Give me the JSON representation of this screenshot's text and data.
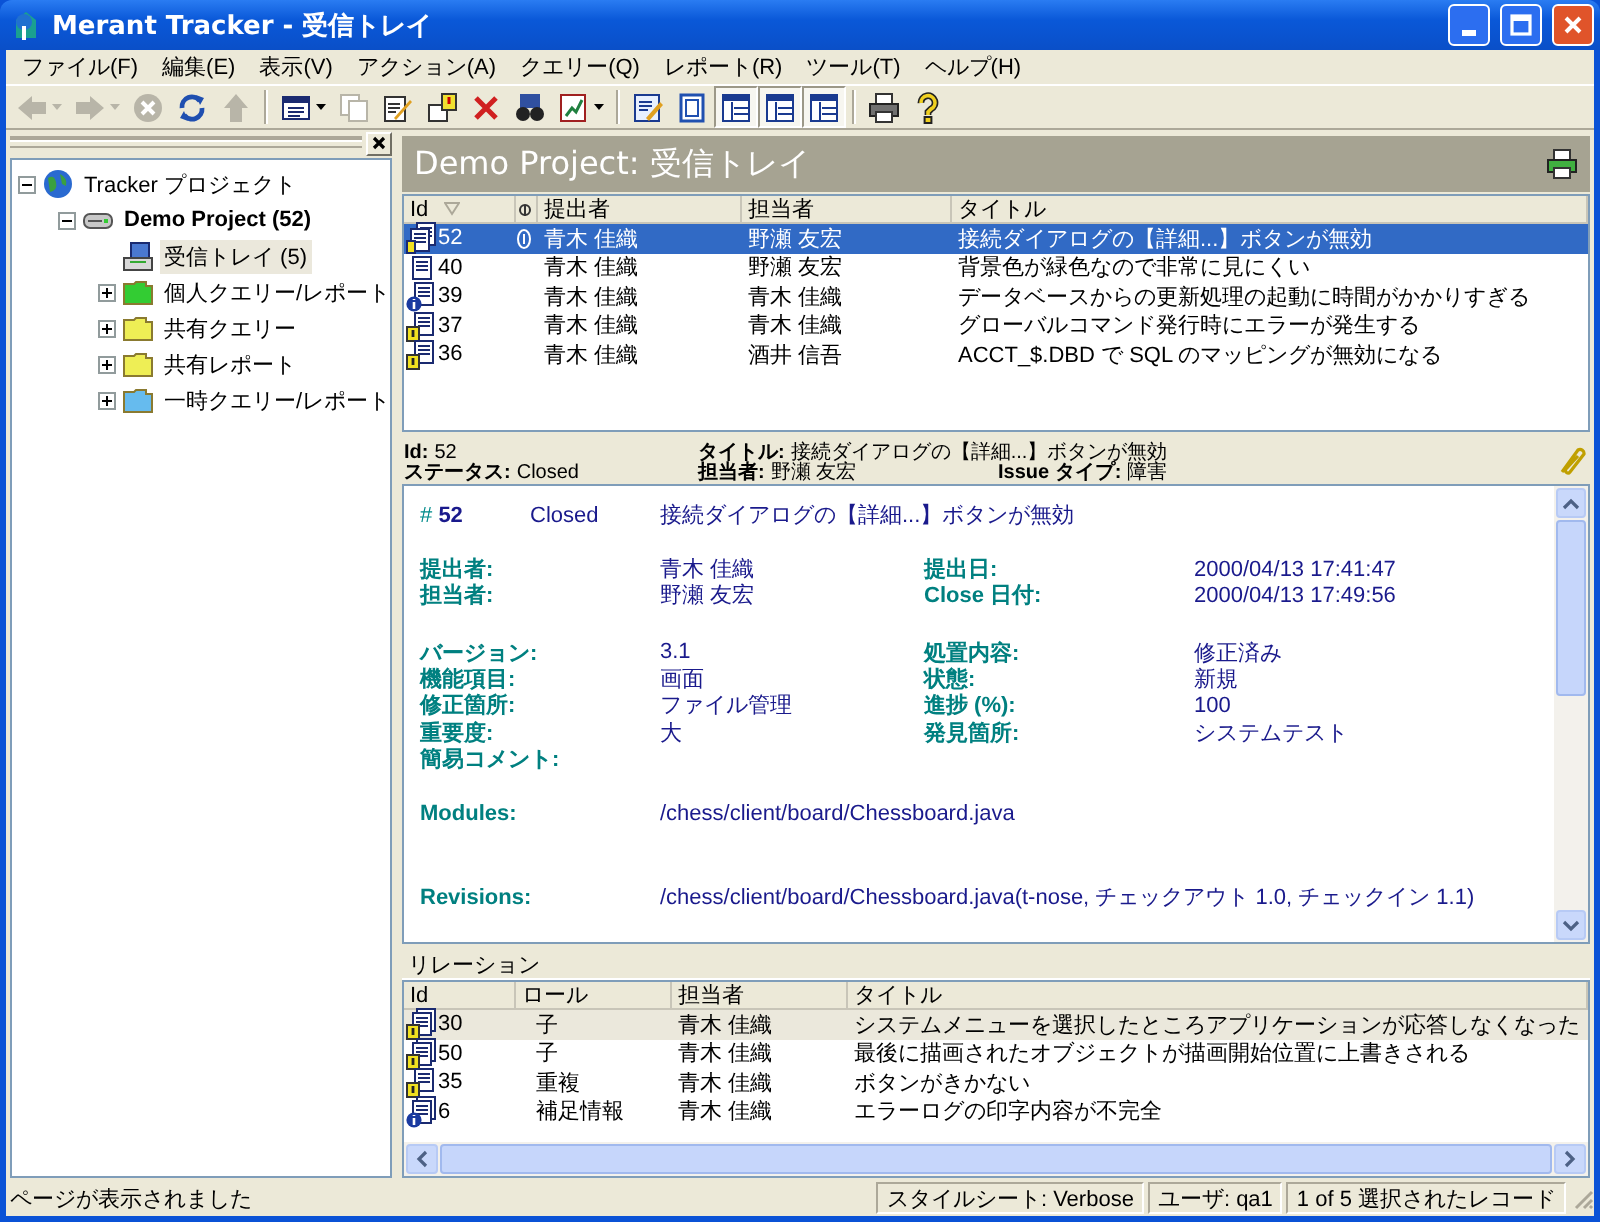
{
  "window": {
    "title": "Merant Tracker - 受信トレイ"
  },
  "menu": [
    "ファイル(F)",
    "編集(E)",
    "表示(V)",
    "アクション(A)",
    "クエリー(Q)",
    "レポート(R)",
    "ツール(T)",
    "ヘルプ(H)"
  ],
  "toolbar": [
    {
      "kind": "back",
      "disabled": true,
      "pressed": false,
      "dropdown": true
    },
    {
      "kind": "forward",
      "disabled": true,
      "pressed": false,
      "dropdown": true
    },
    {
      "kind": "stop",
      "disabled": true,
      "pressed": false
    },
    {
      "kind": "refresh",
      "disabled": false,
      "pressed": false
    },
    {
      "kind": "up",
      "disabled": true,
      "pressed": false
    },
    {
      "kind": "separator"
    },
    {
      "kind": "view",
      "disabled": false,
      "pressed": false,
      "dropdown": true
    },
    {
      "kind": "copy",
      "disabled": true,
      "pressed": false
    },
    {
      "kind": "edit",
      "disabled": false,
      "pressed": false
    },
    {
      "kind": "flag",
      "disabled": false,
      "pressed": false
    },
    {
      "kind": "delete",
      "disabled": false,
      "pressed": false
    },
    {
      "kind": "find",
      "disabled": false,
      "pressed": false
    },
    {
      "kind": "chart",
      "disabled": false,
      "pressed": false,
      "dropdown": true
    },
    {
      "kind": "separator"
    },
    {
      "kind": "note",
      "disabled": false,
      "pressed": false
    },
    {
      "kind": "page",
      "disabled": false,
      "pressed": false
    },
    {
      "kind": "layout",
      "disabled": false,
      "pressed": true
    },
    {
      "kind": "layout",
      "disabled": false,
      "pressed": true
    },
    {
      "kind": "layout",
      "disabled": false,
      "pressed": true
    },
    {
      "kind": "separator"
    },
    {
      "kind": "print",
      "disabled": false,
      "pressed": false
    },
    {
      "kind": "help",
      "disabled": false,
      "pressed": false
    }
  ],
  "tree": [
    {
      "label": "Tracker プロジェクト",
      "kind": "globe",
      "expanded": true,
      "selected": false,
      "children": [
        {
          "label": "Demo Project (52)",
          "kind": "project",
          "expanded": true,
          "selected": false,
          "children": [
            {
              "label": "受信トレイ (5)",
              "kind": "inbox",
              "selected": true
            },
            {
              "label": "個人クエリー/レポート",
              "kind": "folder",
              "color": "#33cc33",
              "expanded": false,
              "selected": false
            },
            {
              "label": "共有クエリー",
              "kind": "folder",
              "color": "#eeee55",
              "expanded": false,
              "selected": false
            },
            {
              "label": "共有レポート",
              "kind": "folder",
              "color": "#eeee55",
              "expanded": false,
              "selected": false
            },
            {
              "label": "一時クエリー/レポート",
              "kind": "folder",
              "color": "#66bbee",
              "expanded": false,
              "selected": false
            }
          ]
        }
      ]
    }
  ],
  "issues": {
    "title": "Demo Project: 受信トレイ",
    "columns": [
      "Id",
      "提出者",
      "担当者",
      "タイトル"
    ],
    "rows": [
      {
        "kind": "linked",
        "id": "52",
        "attachment": true,
        "submitter": "青木 佳織",
        "owner": "野瀬 友宏",
        "title": "接続ダイアログの【詳細...】ボタンが無効",
        "selected": true
      },
      {
        "kind": "doc",
        "id": "40",
        "attachment": false,
        "submitter": "青木 佳織",
        "owner": "野瀬 友宏",
        "title": "背景色が緑色なので非常に見にくい",
        "selected": false
      },
      {
        "kind": "info",
        "id": "39",
        "attachment": false,
        "submitter": "青木 佳織",
        "owner": "青木 佳織",
        "title": "データベースからの更新処理の起動に時間がかかりすぎる",
        "selected": false
      },
      {
        "kind": "alert",
        "id": "37",
        "attachment": false,
        "submitter": "青木 佳織",
        "owner": "青木 佳織",
        "title": "グローバルコマンド発行時にエラーが発生する",
        "selected": false
      },
      {
        "kind": "alert",
        "id": "36",
        "attachment": false,
        "submitter": "青木 佳織",
        "owner": "酒井 信吾",
        "title": "ACCT_$.DBD で SQL のマッピングが無効になる",
        "selected": false
      }
    ]
  },
  "summary": [
    [
      {
        "label": "Id:",
        "value": "52"
      },
      {
        "label": "タイトル:",
        "value": "接続ダイアログの【詳細...】ボタンが無効"
      }
    ],
    [
      {
        "label": "ステータス:",
        "value": "Closed"
      },
      {
        "label": "担当者:",
        "value": "野瀬 友宏"
      },
      {
        "label": "Issue タイプ:",
        "value": "障害"
      }
    ]
  ],
  "detail": {
    "number": "# **52**",
    "status": "Closed",
    "title": "接続ダイアログの【詳細...】ボタンが無効",
    "sections": [
      [
        [
          {
            "label": "提出者:",
            "value": "青木 佳織"
          },
          {
            "label": "提出日:",
            "value": "2000/04/13 17:41:47"
          }
        ],
        [
          {
            "label": "担当者:",
            "value": "野瀬 友宏"
          },
          {
            "label": "Close 日付:",
            "value": "2000/04/13 17:49:56"
          }
        ]
      ],
      [
        [
          {
            "label": "バージョン:",
            "value": "3.1"
          },
          {
            "label": "処置内容:",
            "value": "修正済み"
          }
        ],
        [
          {
            "label": "機能項目:",
            "value": "画面"
          },
          {
            "label": "状態:",
            "value": "新規"
          }
        ],
        [
          {
            "label": "修正箇所:",
            "value": "ファイル管理"
          },
          {
            "label": "進捗 (%):",
            "value": "100"
          }
        ],
        [
          {
            "label": "重要度:",
            "value": "大"
          },
          {
            "label": "発見箇所:",
            "value": "システムテスト"
          }
        ],
        [
          {
            "label": "簡易コメント:"
          }
        ]
      ]
    ],
    "links": [
      {
        "label": "Modules:",
        "value": "/chess/client/board/Chessboard.java"
      },
      {
        "label": "Revisions:",
        "value": "/chess/client/board/Chessboard.java(t-nose, チェックアウト 1.0, チェックイン 1.1)"
      }
    ]
  },
  "relations": {
    "title": "リレーション",
    "columns": [
      "Id",
      "ロール",
      "担当者",
      "タイトル"
    ],
    "rows": [
      {
        "kind": "linked-alert",
        "id": "30",
        "role": "子",
        "owner": "青木 佳織",
        "title": "システムメニューを選択したところアプリケーションが応答しなくなった",
        "selected": true
      },
      {
        "kind": "linked-alert",
        "id": "50",
        "role": "子",
        "owner": "青木 佳織",
        "title": "最後に描画されたオブジェクトが描画開始位置に上書きされる",
        "selected": false
      },
      {
        "kind": "alert",
        "id": "35",
        "role": "重複",
        "owner": "青木 佳織",
        "title": "ボタンがきかない",
        "selected": false
      },
      {
        "kind": "linked-info",
        "id": "6",
        "role": "補足情報",
        "owner": "青木 佳織",
        "title": "エラーログの印字内容が不完全",
        "selected": false
      }
    ]
  },
  "status_bar": {
    "message": "ページが表示されました",
    "panes": [
      "スタイルシート: Verbose",
      "ユーザ: qa1",
      "1 of 5 選択されたレコード"
    ]
  }
}
